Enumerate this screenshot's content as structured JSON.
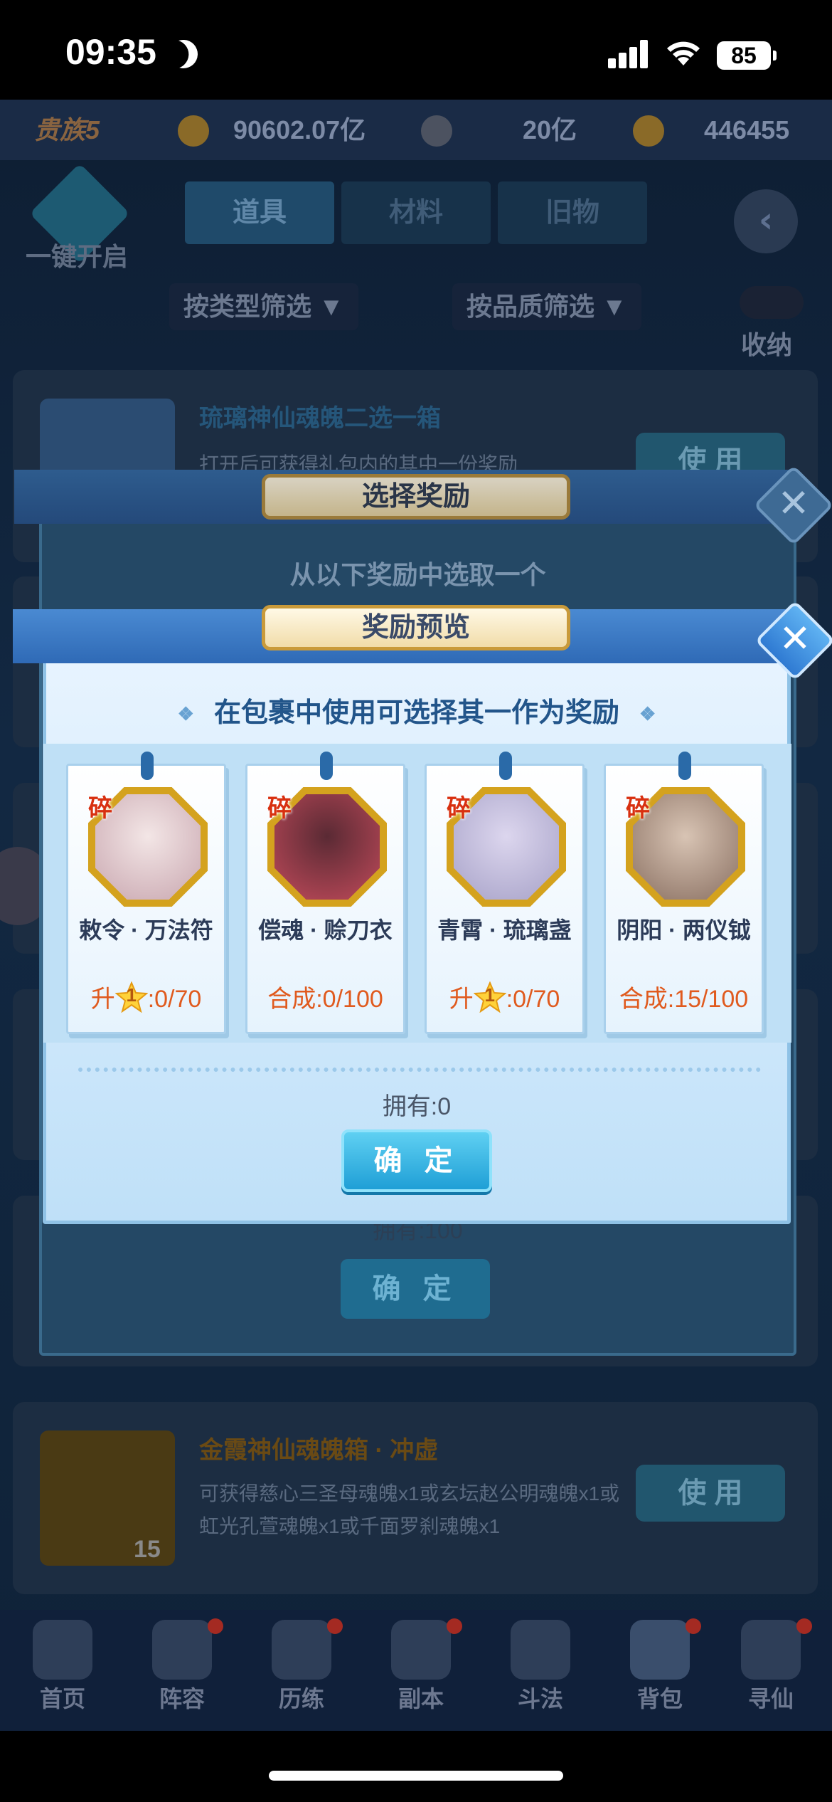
{
  "status_bar": {
    "time": "09:35",
    "battery": "85"
  },
  "top_bar": {
    "rank": "贵族5",
    "currency1": "90602.07亿",
    "currency2": "20亿",
    "currency3": "446455"
  },
  "background": {
    "one_key_open": "一键开启",
    "tabs": [
      "道具",
      "材料",
      "旧物"
    ],
    "filter_type": "按类型筛选",
    "filter_quality": "按品质筛选",
    "collapse": "收纳",
    "card1": {
      "title": "琉璃神仙魂魄二选一箱",
      "desc": "打开后可获得礼包内的其中一份奖励",
      "button": "使 用"
    },
    "card2": {
      "title": "金霞神仙魂魄箱 · 冲虚",
      "desc": "可获得慈心三圣母魂魄x1或玄坛赵公明魂魄x1或虹光孔萱魂魄x1或千面罗刹魂魄x1",
      "count": "15",
      "button": "使 用"
    },
    "nav": [
      "首页",
      "阵容",
      "历练",
      "副本",
      "斗法",
      "背包",
      "寻仙"
    ]
  },
  "dialog_select": {
    "title": "选择奖励",
    "subtitle": "从以下奖励中选取一个",
    "owned": "拥有:100",
    "confirm": "确 定"
  },
  "dialog_preview": {
    "title": "奖励预览",
    "subtitle": "在包裹中使用可选择其一作为奖励",
    "owned": "拥有:0",
    "confirm": "确 定",
    "items": [
      {
        "shard": "碎",
        "name": "敕令 · 万法符",
        "prog_prefix": "升",
        "star": "1",
        "progress": ":0/70",
        "colors": [
          "#f3e6e6",
          "#c9a7b0"
        ]
      },
      {
        "shard": "碎",
        "name": "偿魂 · 赊刀衣",
        "prog_prefix": "合成",
        "star": "",
        "progress": ":0/100",
        "colors": [
          "#5a2a34",
          "#c04a5a"
        ]
      },
      {
        "shard": "碎",
        "name": "青霄 · 琉璃盏",
        "prog_prefix": "升",
        "star": "1",
        "progress": ":0/70",
        "colors": [
          "#dcd6ee",
          "#a7a2c8"
        ]
      },
      {
        "shard": "碎",
        "name": "阴阳 · 两仪钺",
        "prog_prefix": "合成",
        "star": "",
        "progress": ":15/100",
        "colors": [
          "#d8c4b4",
          "#8a7062"
        ]
      }
    ]
  }
}
